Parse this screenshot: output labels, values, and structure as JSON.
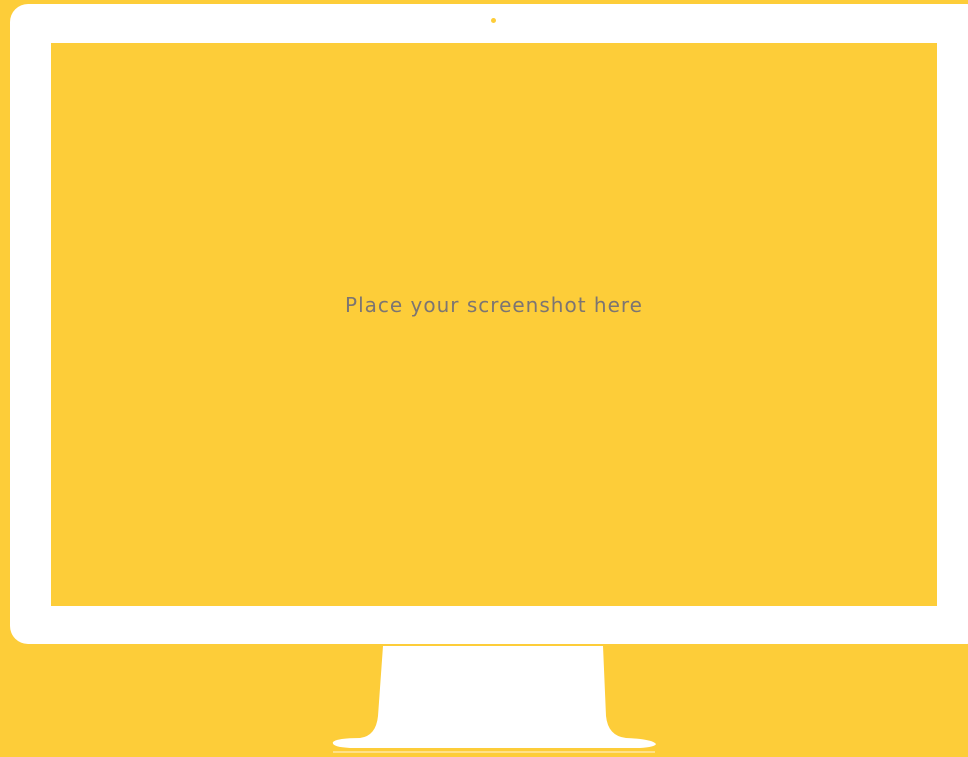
{
  "screen": {
    "placeholder": "Place your screenshot here"
  },
  "colors": {
    "background": "#FDCD39",
    "frame": "#FFFFFF",
    "placeholder_text": "#7C7572"
  },
  "icons": {
    "camera": "camera-dot-icon"
  }
}
